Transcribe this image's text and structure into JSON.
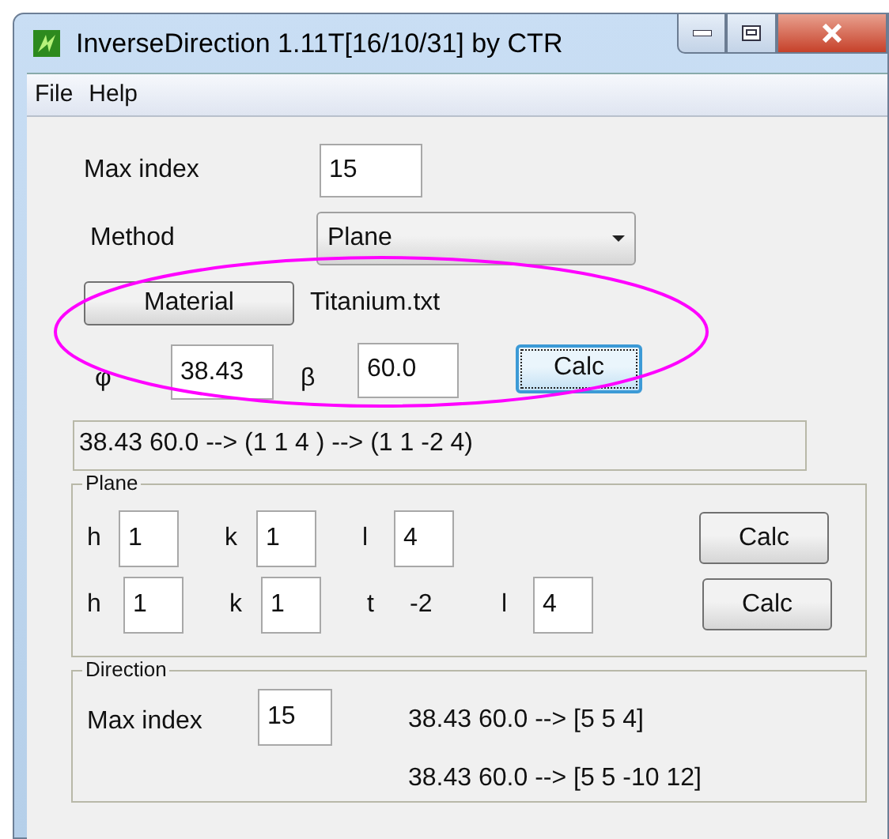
{
  "window": {
    "title": "InverseDirection 1.11T[16/10/31] by CTR"
  },
  "menu": [
    "File",
    "Help"
  ],
  "max_index": {
    "label": "Max index",
    "value": "15"
  },
  "method": {
    "label": "Method",
    "value": "Plane"
  },
  "material": {
    "button": "Material",
    "file": "Titanium.txt"
  },
  "angles": [
    {
      "label": "φ",
      "value": "38.43"
    },
    {
      "label": "β",
      "value": "60.0"
    }
  ],
  "calc_button": {
    "label": "Calc",
    "focused": true
  },
  "result": "38.43 60.0 --> (1 1 4 ) --> (1 1 -2 4)",
  "plane": {
    "title": "Plane",
    "rows": [
      {
        "fields": [
          {
            "kind": "input",
            "label": "h",
            "value": "1"
          },
          {
            "kind": "input",
            "label": "k",
            "value": "1"
          },
          {
            "kind": "input",
            "label": "l",
            "value": "4"
          }
        ],
        "button": "Calc"
      },
      {
        "fields": [
          {
            "kind": "input",
            "label": "h",
            "value": "1"
          },
          {
            "kind": "input",
            "label": "k",
            "value": "1"
          },
          {
            "kind": "text",
            "label": "t",
            "value": "-2"
          },
          {
            "kind": "input",
            "label": "l",
            "value": "4"
          }
        ],
        "button": "Calc"
      }
    ]
  },
  "direction": {
    "title": "Direction",
    "label": "Max index",
    "value": "15",
    "results": [
      "38.43 60.0 --> [5 5 4]",
      "38.43 60.0 --> [5 5 -10 12]"
    ]
  },
  "annotation": {
    "kind": "ellipse",
    "color": "#ff00ff"
  }
}
